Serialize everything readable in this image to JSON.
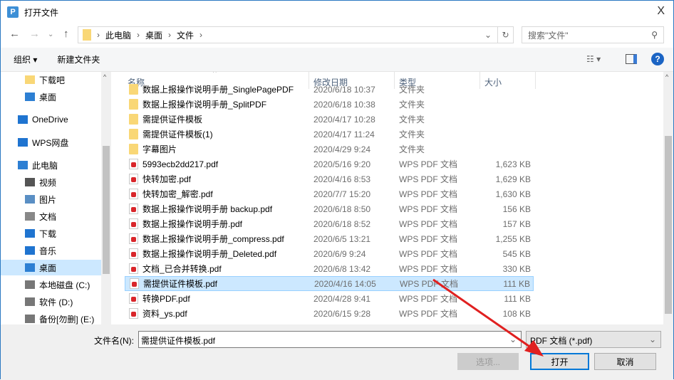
{
  "window": {
    "title": "打开文件",
    "close": "X"
  },
  "address": {
    "crumbs": [
      "此电脑",
      "桌面",
      "文件"
    ],
    "search_placeholder": "搜索\"文件\""
  },
  "toolbar": {
    "organize": "组织 ▾",
    "new_folder": "新建文件夹"
  },
  "sidebar": [
    {
      "label": "下载吧",
      "icon": "folder-icon"
    },
    {
      "label": "桌面",
      "icon": "desktop-icon"
    },
    {
      "label": "OneDrive",
      "icon": "cloud-icon"
    },
    {
      "label": "WPS网盘",
      "icon": "cloud-icon"
    },
    {
      "label": "此电脑",
      "icon": "computer-icon"
    },
    {
      "label": "视频",
      "icon": "video-icon"
    },
    {
      "label": "图片",
      "icon": "picture-icon"
    },
    {
      "label": "文档",
      "icon": "document-icon"
    },
    {
      "label": "下载",
      "icon": "download-icon"
    },
    {
      "label": "音乐",
      "icon": "music-icon"
    },
    {
      "label": "桌面",
      "icon": "desktop-icon",
      "selected": true
    },
    {
      "label": "本地磁盘 (C:)",
      "icon": "drive-icon"
    },
    {
      "label": "软件 (D:)",
      "icon": "drive-icon"
    },
    {
      "label": "备份[勿删] (E:)",
      "icon": "drive-icon"
    }
  ],
  "columns": [
    "名称",
    "修改日期",
    "类型",
    "大小"
  ],
  "files": [
    {
      "name": "数据上报操作说明手册_SinglePagePDF",
      "date": "2020/6/18 10:37",
      "type": "文件夹",
      "size": "",
      "kind": "folder"
    },
    {
      "name": "数据上报操作说明手册_SplitPDF",
      "date": "2020/6/18 10:38",
      "type": "文件夹",
      "size": "",
      "kind": "folder"
    },
    {
      "name": "需提供证件模板",
      "date": "2020/4/17 10:28",
      "type": "文件夹",
      "size": "",
      "kind": "folder"
    },
    {
      "name": "需提供证件模板(1)",
      "date": "2020/4/17 11:24",
      "type": "文件夹",
      "size": "",
      "kind": "folder"
    },
    {
      "name": "字幕图片",
      "date": "2020/4/29 9:24",
      "type": "文件夹",
      "size": "",
      "kind": "folder"
    },
    {
      "name": "5993ecb2dd217.pdf",
      "date": "2020/5/16 9:20",
      "type": "WPS PDF 文档",
      "size": "1,623 KB",
      "kind": "pdf"
    },
    {
      "name": "快转加密.pdf",
      "date": "2020/4/16 8:53",
      "type": "WPS PDF 文档",
      "size": "1,629 KB",
      "kind": "pdf"
    },
    {
      "name": "快转加密_解密.pdf",
      "date": "2020/7/7 15:20",
      "type": "WPS PDF 文档",
      "size": "1,630 KB",
      "kind": "pdf"
    },
    {
      "name": "数据上报操作说明手册 backup.pdf",
      "date": "2020/6/18 8:50",
      "type": "WPS PDF 文档",
      "size": "156 KB",
      "kind": "pdf"
    },
    {
      "name": "数据上报操作说明手册.pdf",
      "date": "2020/6/18 8:52",
      "type": "WPS PDF 文档",
      "size": "157 KB",
      "kind": "pdf"
    },
    {
      "name": "数据上报操作说明手册_compress.pdf",
      "date": "2020/6/5 13:21",
      "type": "WPS PDF 文档",
      "size": "1,255 KB",
      "kind": "pdf"
    },
    {
      "name": "数据上报操作说明手册_Deleted.pdf",
      "date": "2020/6/9 9:24",
      "type": "WPS PDF 文档",
      "size": "545 KB",
      "kind": "pdf"
    },
    {
      "name": "文档_已合并转换.pdf",
      "date": "2020/6/8 13:42",
      "type": "WPS PDF 文档",
      "size": "330 KB",
      "kind": "pdf"
    },
    {
      "name": "需提供证件模板.pdf",
      "date": "2020/4/16 14:05",
      "type": "WPS PDF 文档",
      "size": "111 KB",
      "kind": "pdf",
      "selected": true
    },
    {
      "name": "转换PDF.pdf",
      "date": "2020/4/28 9:41",
      "type": "WPS PDF 文档",
      "size": "111 KB",
      "kind": "pdf"
    },
    {
      "name": "资料_ys.pdf",
      "date": "2020/6/15 9:28",
      "type": "WPS PDF 文档",
      "size": "108 KB",
      "kind": "pdf"
    }
  ],
  "footer": {
    "filename_label": "文件名(N):",
    "filename_value": "需提供证件模板.pdf",
    "filter": "PDF 文档 (*.pdf)",
    "options": "选项...",
    "open": "打开",
    "cancel": "取消"
  },
  "colors": {
    "accent": "#0078d7",
    "selection": "#cce8ff",
    "arrow": "#e02020"
  }
}
